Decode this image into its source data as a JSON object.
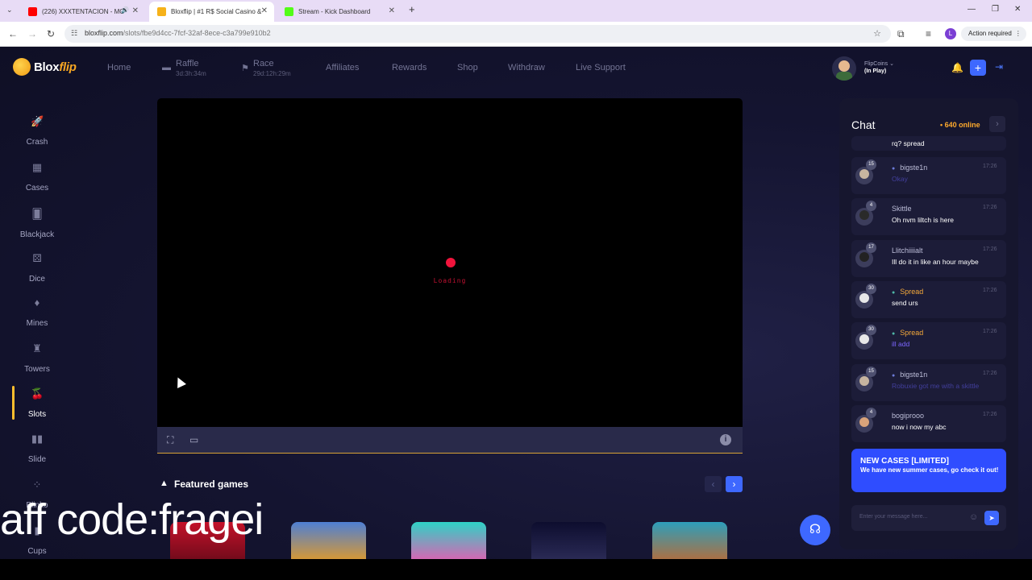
{
  "browser": {
    "tabs": [
      {
        "label": "(226) XXXTENTACION - MO",
        "fav_color": "#ff0000",
        "active": false
      },
      {
        "label": "Bloxflip | #1 R$ Social Casino &",
        "fav_color": "#f6b21a",
        "active": true
      },
      {
        "label": "Stream - Kick Dashboard",
        "fav_color": "#53fc18",
        "active": false
      }
    ],
    "url_host": "bloxflip.com",
    "url_path": "/slots/fbe9d4cc-7fcf-32af-8ece-c3a799e910b2",
    "action_required": "Action required",
    "profile_letter": "L"
  },
  "brand": {
    "name_a": "Blox",
    "name_b": "flip"
  },
  "topnav": {
    "home": "Home",
    "raffle": "Raffle",
    "raffle_timer": "3d:3h:34m",
    "race": "Race",
    "race_timer": "29d:12h:29m",
    "affiliates": "Affiliates",
    "rewards": "Rewards",
    "shop": "Shop",
    "withdraw": "Withdraw",
    "live_support": "Live Support"
  },
  "user": {
    "name": "FlipCoins",
    "status": "(In Play)"
  },
  "sidebar": {
    "items": [
      {
        "label": "Crash",
        "icon": "rocket-icon"
      },
      {
        "label": "Cases",
        "icon": "cases-icon"
      },
      {
        "label": "Blackjack",
        "icon": "cards-icon"
      },
      {
        "label": "Dice",
        "icon": "dice-icon"
      },
      {
        "label": "Mines",
        "icon": "gem-icon"
      },
      {
        "label": "Towers",
        "icon": "tower-icon"
      },
      {
        "label": "Slots",
        "icon": "cherry-icon"
      },
      {
        "label": "Slide",
        "icon": "slide-icon"
      },
      {
        "label": "Plinko",
        "icon": "plinko-icon"
      },
      {
        "label": "Cups",
        "icon": "cups-icon"
      }
    ],
    "active": "Slots"
  },
  "game": {
    "loading_text": "Loading"
  },
  "featured": {
    "title": "Featured games"
  },
  "chat": {
    "title": "Chat",
    "online": "• 640 online",
    "partial_message": "rq? spread",
    "messages": [
      {
        "user": "bigste1n",
        "level": "15",
        "time": "17:26",
        "text": "Okay",
        "style": "faded"
      },
      {
        "user": "Skittle",
        "level": "4",
        "time": "17:26",
        "text": "Oh nvm liltch is here",
        "style": "normal"
      },
      {
        "user": "Llitchiiiialt",
        "level": "17",
        "time": "17:26",
        "text": "Ill do it in like an hour maybe",
        "style": "normal"
      },
      {
        "user": "Spread",
        "level": "30",
        "time": "17:26",
        "text": "send urs",
        "style": "normal"
      },
      {
        "user": "Spread",
        "level": "30",
        "time": "17:26",
        "text": "ill add",
        "style": "purple"
      },
      {
        "user": "bigste1n",
        "level": "15",
        "time": "17:26",
        "text": "Robuxie got me with a skittle",
        "style": "faded"
      },
      {
        "user": "bogiprooo",
        "level": "4",
        "time": "17:26",
        "text": "now i now my abc",
        "style": "normal"
      }
    ],
    "promo_title": "NEW CASES [LIMITED]",
    "promo_body": "We have new summer cases, go check it out!",
    "input_placeholder": "Enter your message here..."
  },
  "overlay": {
    "text": "aff code:fragei"
  },
  "colors": {
    "accent": "#3e68ff",
    "gold": "#ffbe2e",
    "bg": "#141430"
  }
}
